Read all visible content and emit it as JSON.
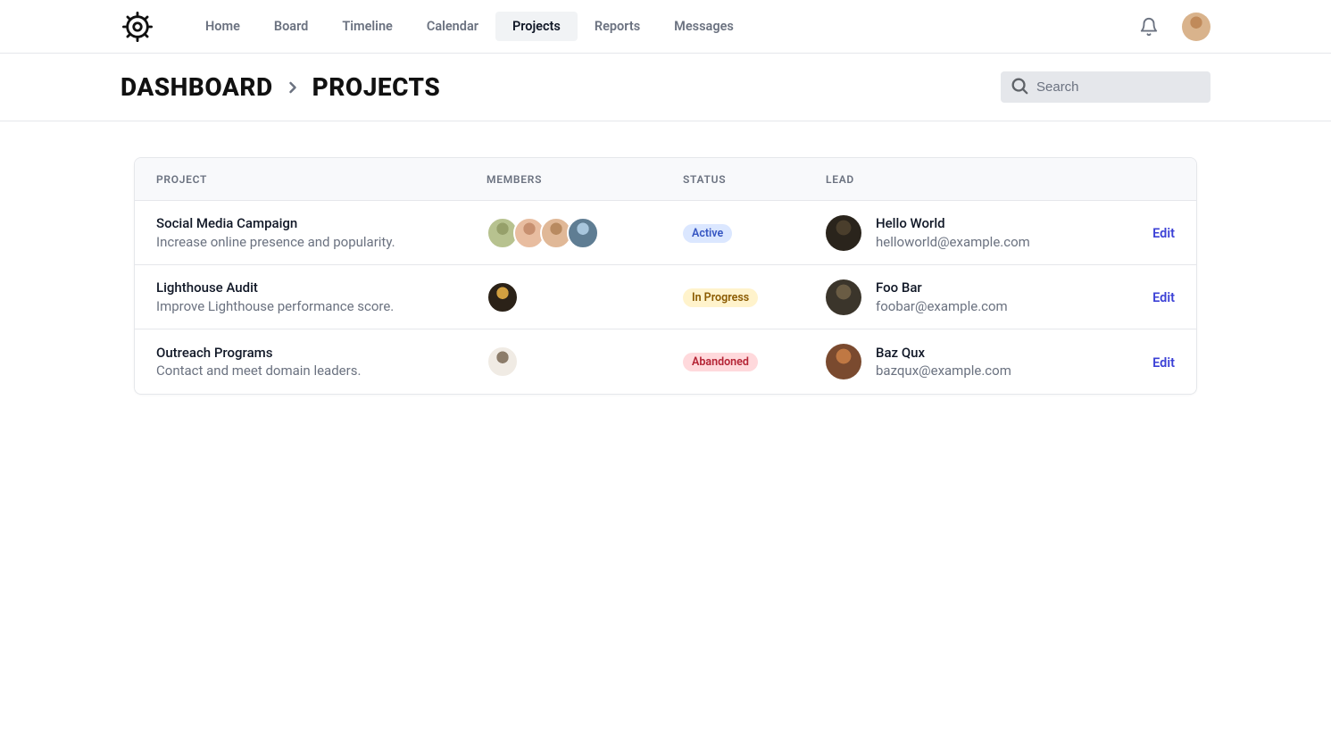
{
  "nav": {
    "items": [
      {
        "label": "Home",
        "active": false
      },
      {
        "label": "Board",
        "active": false
      },
      {
        "label": "Timeline",
        "active": false
      },
      {
        "label": "Calendar",
        "active": false
      },
      {
        "label": "Projects",
        "active": true
      },
      {
        "label": "Reports",
        "active": false
      },
      {
        "label": "Messages",
        "active": false
      }
    ]
  },
  "breadcrumb": {
    "items": [
      "DASHBOARD",
      "PROJECTS"
    ]
  },
  "search": {
    "placeholder": "Search",
    "value": ""
  },
  "avatar_colors": {
    "topbar": [
      "#d9b38c",
      "#c08a5a"
    ],
    "members": {
      "0": [
        [
          "#b7c28f",
          "#96a06a"
        ],
        [
          "#e8bda0",
          "#c79070"
        ],
        [
          "#e0b897",
          "#b88a60"
        ],
        [
          "#5f7d93",
          "#a8c6dd"
        ]
      ],
      "1": [
        [
          "#2b2218",
          "#d2a040"
        ]
      ],
      "2": [
        [
          "#f0ebe4",
          "#8c7c6a"
        ]
      ]
    },
    "leads": [
      [
        "#2a241c",
        "#4a3e2c"
      ],
      [
        "#3b352b",
        "#6a5c44"
      ],
      [
        "#7a4a2f",
        "#c07843"
      ]
    ]
  },
  "table": {
    "headers": {
      "project": "PROJECT",
      "members": "MEMBERS",
      "status": "STATUS",
      "lead": "LEAD"
    },
    "rows": [
      {
        "name": "Social Media Campaign",
        "description": "Increase online presence and popularity.",
        "member_count": 4,
        "status": {
          "label": "Active",
          "bg": "#dbe7ff",
          "fg": "#3656c2"
        },
        "lead": {
          "name": "Hello World",
          "email": "helloworld@example.com"
        },
        "action": "Edit"
      },
      {
        "name": "Lighthouse Audit",
        "description": "Improve Lighthouse performance score.",
        "member_count": 1,
        "status": {
          "label": "In Progress",
          "bg": "#fff3cc",
          "fg": "#8a5a00"
        },
        "lead": {
          "name": "Foo Bar",
          "email": "foobar@example.com"
        },
        "action": "Edit"
      },
      {
        "name": "Outreach Programs",
        "description": "Contact and meet domain leaders.",
        "member_count": 1,
        "status": {
          "label": "Abandoned",
          "bg": "#ffd9dc",
          "fg": "#b42334"
        },
        "lead": {
          "name": "Baz Qux",
          "email": "bazqux@example.com"
        },
        "action": "Edit"
      }
    ]
  }
}
